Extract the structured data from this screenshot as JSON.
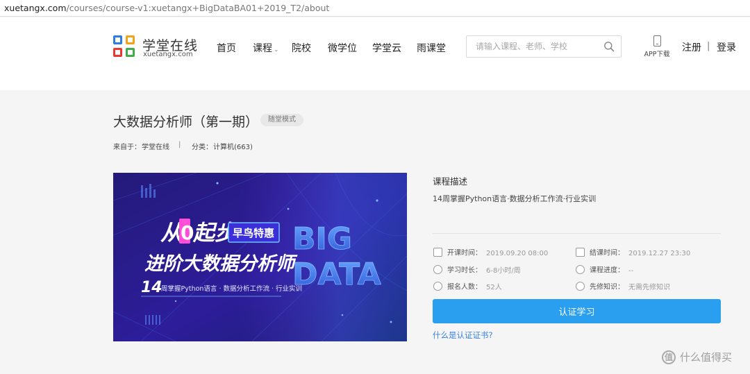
{
  "browser": {
    "url_host": "xuetangx.com",
    "url_path": "/courses/course-v1:xuetangx+BigDataBA01+2019_T2/about"
  },
  "header": {
    "logo_cn": "学堂在线",
    "logo_en": "xuetangx.com",
    "nav": [
      "首页",
      "课程",
      "院校",
      "微学位",
      "学堂云",
      "雨课堂"
    ],
    "search_placeholder": "请输入课程、老师、学校",
    "app_label": "APP下载",
    "register": "注册",
    "login": "登录",
    "separator": "|"
  },
  "course": {
    "title": "大数据分析师（第一期）",
    "mode": "随堂模式",
    "source_label": "来自于：",
    "source_value": "学堂在线",
    "divider": "|",
    "category_label": "分类：",
    "category_value": "计算机(663)"
  },
  "banner": {
    "line1_a": "从",
    "line1_zero": "0",
    "line1_b": "起步",
    "badge": "早鸟特惠",
    "line2": "进阶大数据分析师",
    "line3_num": "14",
    "line3_text": "周掌握Python语言 · 数据分析工作流 · 行业实训",
    "big": "BIG",
    "data": "DATA"
  },
  "details": {
    "desc_heading": "课程描述",
    "desc_text": "14周掌握Python语言·数据分析工作流·行业实训",
    "info": {
      "start_label": "开课时间：",
      "start_value": "2019.09.20 08:00",
      "end_label": "结课时间：",
      "end_value": "2019.12.27 23:30",
      "duration_label": "学习时长：",
      "duration_value": "6-8小时/周",
      "progress_label": "课程进度：",
      "progress_value": "--",
      "enrolled_label": "报名人数：",
      "enrolled_value": "52人",
      "prereq_label": "先修知识：",
      "prereq_value": "无需先修知识"
    },
    "cta": "认证学习",
    "cert_link": "什么是认证证书?"
  },
  "watermark": {
    "text": "什么值得买",
    "icon_char": "值"
  },
  "colors": {
    "link": "#3b82e0",
    "cta": "#2a9ff0",
    "banner_bg": "#2b1a8f"
  }
}
